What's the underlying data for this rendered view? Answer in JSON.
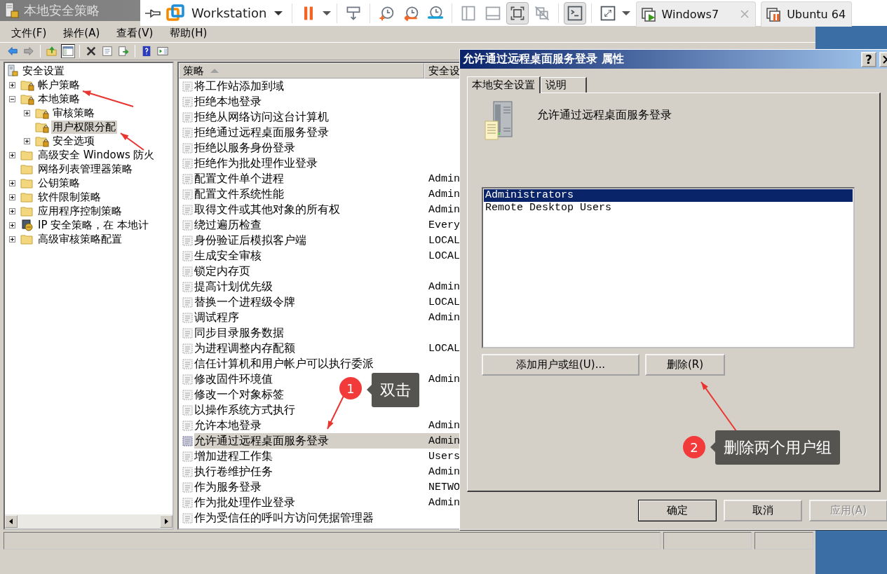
{
  "mmc": {
    "title": "本地安全策略",
    "menu": [
      {
        "label": "文件(F)"
      },
      {
        "label": "操作(A)"
      },
      {
        "label": "查看(V)"
      },
      {
        "label": "帮助(H)"
      }
    ],
    "toolbar": [
      {
        "kind": "back",
        "pressed": false
      },
      {
        "kind": "forward",
        "pressed": false
      },
      {
        "kind": "separator"
      },
      {
        "kind": "up",
        "pressed": false
      },
      {
        "kind": "tree_toggle",
        "pressed": true
      },
      {
        "kind": "separator"
      },
      {
        "kind": "delete",
        "pressed": false
      },
      {
        "kind": "properties",
        "pressed": false
      },
      {
        "kind": "export",
        "pressed": false
      },
      {
        "kind": "separator"
      },
      {
        "kind": "help",
        "pressed": false
      },
      {
        "kind": "action_pane",
        "pressed": false
      }
    ],
    "tree": {
      "label": "安全设置",
      "kind": "root",
      "selected": false,
      "children": [
        {
          "label": "帐户策略",
          "kind": "locked_folder",
          "collapsible": true,
          "expanded": false,
          "selected": false
        },
        {
          "label": "本地策略",
          "kind": "locked_folder",
          "collapsible": true,
          "expanded": true,
          "selected": false,
          "children": [
            {
              "label": "审核策略",
              "kind": "locked_folder",
              "collapsible": true,
              "expanded": false,
              "selected": false
            },
            {
              "label": "用户权限分配",
              "kind": "locked_folder",
              "collapsible": false,
              "selected": true
            },
            {
              "label": "安全选项",
              "kind": "locked_folder",
              "collapsible": true,
              "expanded": false,
              "selected": false
            }
          ]
        },
        {
          "label": "高级安全 Windows 防火",
          "kind": "folder",
          "collapsible": true,
          "expanded": false,
          "selected": false
        },
        {
          "label": "网络列表管理器策略",
          "kind": "folder",
          "collapsible": false,
          "selected": false
        },
        {
          "label": "公钥策略",
          "kind": "folder",
          "collapsible": true,
          "expanded": false,
          "selected": false
        },
        {
          "label": "软件限制策略",
          "kind": "folder",
          "collapsible": true,
          "expanded": false,
          "selected": false
        },
        {
          "label": "应用程序控制策略",
          "kind": "folder",
          "collapsible": true,
          "expanded": false,
          "selected": false
        },
        {
          "label": "IP 安全策略，在 本地计",
          "kind": "network_policy",
          "collapsible": true,
          "expanded": false,
          "selected": false
        },
        {
          "label": "高级审核策略配置",
          "kind": "folder",
          "collapsible": true,
          "expanded": false,
          "selected": false
        }
      ]
    },
    "list": {
      "columns": [
        {
          "label": "策略",
          "sort_ascending": true
        },
        {
          "label": "安全设",
          "sort_ascending": false
        }
      ],
      "rows": [
        {
          "policy": "将工作站添加到域",
          "selected": false
        },
        {
          "policy": "拒绝本地登录",
          "selected": false
        },
        {
          "policy": "拒绝从网络访问这台计算机",
          "selected": false
        },
        {
          "policy": "拒绝通过远程桌面服务登录",
          "selected": false
        },
        {
          "policy": "拒绝以服务身份登录",
          "selected": false
        },
        {
          "policy": "拒绝作为批处理作业登录",
          "selected": false
        },
        {
          "policy": "配置文件单个进程",
          "setting": "Admin",
          "selected": false
        },
        {
          "policy": "配置文件系统性能",
          "setting": "Admin",
          "selected": false
        },
        {
          "policy": "取得文件或其他对象的所有权",
          "setting": "Admin",
          "selected": false
        },
        {
          "policy": "绕过遍历检查",
          "setting": "Every",
          "selected": false
        },
        {
          "policy": "身份验证后模拟客户端",
          "setting": "LOCAL",
          "selected": false
        },
        {
          "policy": "生成安全审核",
          "setting": "LOCAL",
          "selected": false
        },
        {
          "policy": "锁定内存页",
          "selected": false
        },
        {
          "policy": "提高计划优先级",
          "setting": "Admin",
          "selected": false
        },
        {
          "policy": "替换一个进程级令牌",
          "setting": "LOCAL",
          "selected": false
        },
        {
          "policy": "调试程序",
          "setting": "Admin",
          "selected": false
        },
        {
          "policy": "同步目录服务数据",
          "selected": false
        },
        {
          "policy": "为进程调整内存配额",
          "setting": "LOCAL",
          "selected": false
        },
        {
          "policy": "信任计算机和用户帐户可以执行委派",
          "selected": false
        },
        {
          "policy": "修改固件环境值",
          "setting": "Admin",
          "selected": false
        },
        {
          "policy": "修改一个对象标签",
          "selected": false
        },
        {
          "policy": "以操作系统方式执行",
          "selected": false
        },
        {
          "policy": "允许本地登录",
          "setting": "Admin",
          "selected": false
        },
        {
          "policy": "允许通过远程桌面服务登录",
          "setting": "Admin",
          "selected": true
        },
        {
          "policy": "增加进程工作集",
          "setting": "Users",
          "selected": false
        },
        {
          "policy": "执行卷维护任务",
          "setting": "Admin",
          "selected": false
        },
        {
          "policy": "作为服务登录",
          "setting": "NETWO",
          "selected": false
        },
        {
          "policy": "作为批处理作业登录",
          "setting": "Admin",
          "selected": false
        },
        {
          "policy": "作为受信任的呼叫方访问凭据管理器",
          "selected": false
        }
      ]
    }
  },
  "vmware_toolbar": {
    "product": "Workstation",
    "buttons": [
      {
        "kind": "pause",
        "pressed": false
      },
      {
        "kind": "caret"
      },
      {
        "kind": "separator"
      },
      {
        "kind": "send_keys",
        "pressed": false
      },
      {
        "kind": "separator"
      },
      {
        "kind": "snapshot_take",
        "pressed": false
      },
      {
        "kind": "snapshot_revert",
        "pressed": false
      },
      {
        "kind": "snapshot_manager",
        "pressed": false
      },
      {
        "kind": "separator"
      },
      {
        "kind": "library",
        "pressed": false
      },
      {
        "kind": "thumbnail",
        "pressed": false
      },
      {
        "kind": "fit",
        "pressed": true
      },
      {
        "kind": "no_stretch",
        "pressed": false
      },
      {
        "kind": "separator"
      },
      {
        "kind": "console",
        "pressed": true
      },
      {
        "kind": "separator"
      },
      {
        "kind": "fullscreen",
        "pressed": false
      },
      {
        "kind": "caret"
      }
    ],
    "tabs": [
      {
        "label": "Windows7",
        "running": true,
        "selected": false,
        "closable": true
      },
      {
        "label": "Ubuntu 64",
        "running": false,
        "selected": false,
        "closable": false
      }
    ]
  },
  "dialog": {
    "title": "允许通过远程桌面服务登录 属性",
    "help_button": "?",
    "tabs": [
      {
        "label": "本地安全设置",
        "selected": true
      },
      {
        "label": "说明",
        "selected": false
      }
    ],
    "policy_name": "允许通过远程桌面服务登录",
    "members": [
      {
        "name": "Administrators",
        "selected": true
      },
      {
        "name": "Remote Desktop Users",
        "selected": false
      }
    ],
    "member_buttons": [
      "添加用户或组(U)...",
      "删除(R)"
    ],
    "footer_buttons": [
      {
        "label": "确定",
        "default": true,
        "disabled": false
      },
      {
        "label": "取消",
        "default": false,
        "disabled": false
      },
      {
        "label": "应用(A)",
        "default": false,
        "disabled": true
      }
    ]
  },
  "annotations": [
    {
      "number": "1",
      "text": "双击"
    },
    {
      "number": "2",
      "text": "删除两个用户组"
    }
  ]
}
